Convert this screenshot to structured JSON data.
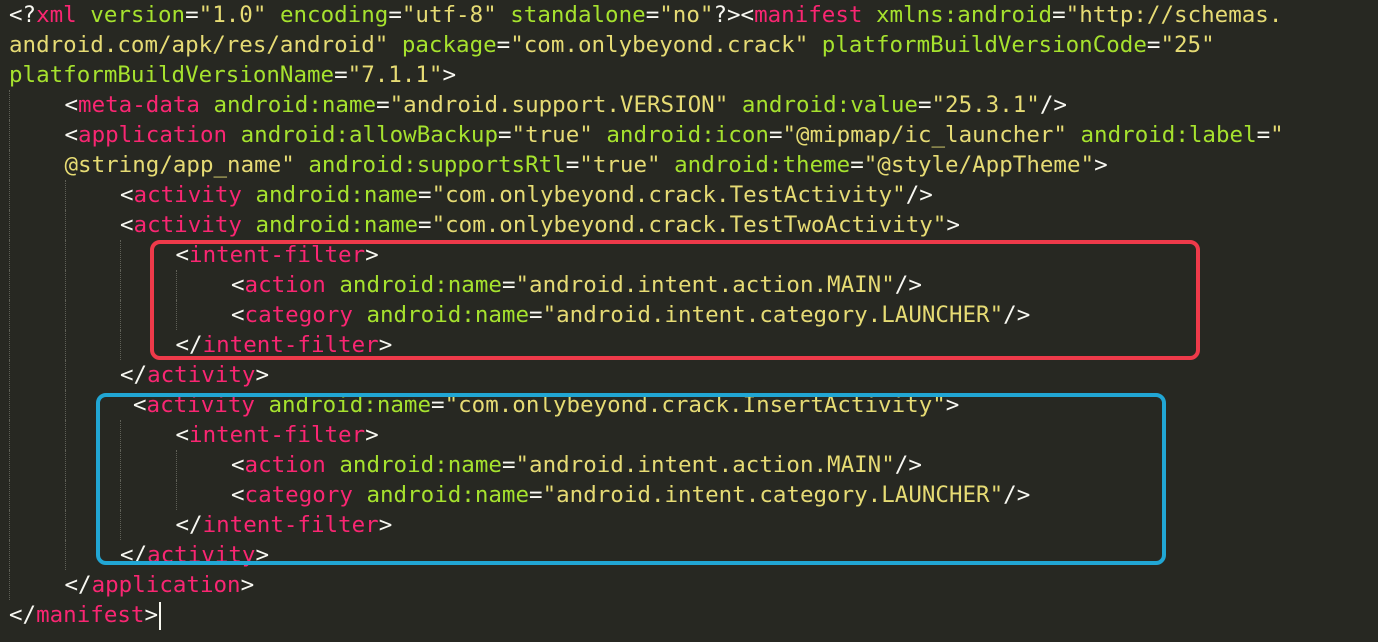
{
  "editor": {
    "theme_colors": {
      "background": "#272822",
      "tag": "#f92672",
      "attribute": "#a6e22e",
      "string": "#e6db74",
      "punctuation": "#f8f8f2"
    },
    "lines": [
      {
        "indent": 0,
        "tokens": [
          {
            "t": "<?",
            "c": "punct"
          },
          {
            "t": "xml",
            "c": "tag"
          },
          {
            "t": " ",
            "c": "plain"
          },
          {
            "t": "version",
            "c": "attr"
          },
          {
            "t": "=",
            "c": "punct"
          },
          {
            "t": "\"1.0\"",
            "c": "str"
          },
          {
            "t": " ",
            "c": "plain"
          },
          {
            "t": "encoding",
            "c": "attr"
          },
          {
            "t": "=",
            "c": "punct"
          },
          {
            "t": "\"utf-8\"",
            "c": "str"
          },
          {
            "t": " ",
            "c": "plain"
          },
          {
            "t": "standalone",
            "c": "attr"
          },
          {
            "t": "=",
            "c": "punct"
          },
          {
            "t": "\"no\"",
            "c": "str"
          },
          {
            "t": "?><",
            "c": "punct"
          },
          {
            "t": "manifest",
            "c": "tag"
          },
          {
            "t": " ",
            "c": "plain"
          },
          {
            "t": "xmlns:android",
            "c": "attr"
          },
          {
            "t": "=",
            "c": "punct"
          },
          {
            "t": "\"http://schemas.",
            "c": "str"
          }
        ]
      },
      {
        "indent": 0,
        "tokens": [
          {
            "t": "android.com/apk/res/android\"",
            "c": "str"
          },
          {
            "t": " ",
            "c": "plain"
          },
          {
            "t": "package",
            "c": "attr"
          },
          {
            "t": "=",
            "c": "punct"
          },
          {
            "t": "\"com.onlybeyond.crack\"",
            "c": "str"
          },
          {
            "t": " ",
            "c": "plain"
          },
          {
            "t": "platformBuildVersionCode",
            "c": "attr"
          },
          {
            "t": "=",
            "c": "punct"
          },
          {
            "t": "\"25\"",
            "c": "str"
          }
        ]
      },
      {
        "indent": 0,
        "tokens": [
          {
            "t": "platformBuildVersionName",
            "c": "attr"
          },
          {
            "t": "=",
            "c": "punct"
          },
          {
            "t": "\"7.1.1\"",
            "c": "str"
          },
          {
            "t": ">",
            "c": "punct"
          }
        ]
      },
      {
        "indent": 1,
        "tokens": [
          {
            "t": "<",
            "c": "punct"
          },
          {
            "t": "meta-data",
            "c": "tag"
          },
          {
            "t": " ",
            "c": "plain"
          },
          {
            "t": "android:name",
            "c": "attr"
          },
          {
            "t": "=",
            "c": "punct"
          },
          {
            "t": "\"android.support.VERSION\"",
            "c": "str"
          },
          {
            "t": " ",
            "c": "plain"
          },
          {
            "t": "android:value",
            "c": "attr"
          },
          {
            "t": "=",
            "c": "punct"
          },
          {
            "t": "\"25.3.1\"",
            "c": "str"
          },
          {
            "t": "/>",
            "c": "punct"
          }
        ]
      },
      {
        "indent": 1,
        "tokens": [
          {
            "t": "<",
            "c": "punct"
          },
          {
            "t": "application",
            "c": "tag"
          },
          {
            "t": " ",
            "c": "plain"
          },
          {
            "t": "android:allowBackup",
            "c": "attr"
          },
          {
            "t": "=",
            "c": "punct"
          },
          {
            "t": "\"true\"",
            "c": "str"
          },
          {
            "t": " ",
            "c": "plain"
          },
          {
            "t": "android:icon",
            "c": "attr"
          },
          {
            "t": "=",
            "c": "punct"
          },
          {
            "t": "\"@mipmap/ic_launcher\"",
            "c": "str"
          },
          {
            "t": " ",
            "c": "plain"
          },
          {
            "t": "android:label",
            "c": "attr"
          },
          {
            "t": "=",
            "c": "punct"
          },
          {
            "t": "\"",
            "c": "str"
          }
        ]
      },
      {
        "indent": 1,
        "tokens": [
          {
            "t": "@string/app_name\"",
            "c": "str"
          },
          {
            "t": " ",
            "c": "plain"
          },
          {
            "t": "android:supportsRtl",
            "c": "attr"
          },
          {
            "t": "=",
            "c": "punct"
          },
          {
            "t": "\"true\"",
            "c": "str"
          },
          {
            "t": " ",
            "c": "plain"
          },
          {
            "t": "android:theme",
            "c": "attr"
          },
          {
            "t": "=",
            "c": "punct"
          },
          {
            "t": "\"@style/AppTheme\"",
            "c": "str"
          },
          {
            "t": ">",
            "c": "punct"
          }
        ]
      },
      {
        "indent": 2,
        "tokens": [
          {
            "t": "<",
            "c": "punct"
          },
          {
            "t": "activity",
            "c": "tag"
          },
          {
            "t": " ",
            "c": "plain"
          },
          {
            "t": "android:name",
            "c": "attr"
          },
          {
            "t": "=",
            "c": "punct"
          },
          {
            "t": "\"com.onlybeyond.crack.TestActivity\"",
            "c": "str"
          },
          {
            "t": "/>",
            "c": "punct"
          }
        ]
      },
      {
        "indent": 2,
        "tokens": [
          {
            "t": "<",
            "c": "punct"
          },
          {
            "t": "activity",
            "c": "tag"
          },
          {
            "t": " ",
            "c": "plain"
          },
          {
            "t": "android:name",
            "c": "attr"
          },
          {
            "t": "=",
            "c": "punct"
          },
          {
            "t": "\"com.onlybeyond.crack.TestTwoActivity\"",
            "c": "str"
          },
          {
            "t": ">",
            "c": "punct"
          }
        ]
      },
      {
        "indent": 3,
        "tokens": [
          {
            "t": "<",
            "c": "punct"
          },
          {
            "t": "intent-filter",
            "c": "tag"
          },
          {
            "t": ">",
            "c": "punct"
          }
        ]
      },
      {
        "indent": 4,
        "tokens": [
          {
            "t": "<",
            "c": "punct"
          },
          {
            "t": "action",
            "c": "tag"
          },
          {
            "t": " ",
            "c": "plain"
          },
          {
            "t": "android:name",
            "c": "attr"
          },
          {
            "t": "=",
            "c": "punct"
          },
          {
            "t": "\"android.intent.action.MAIN\"",
            "c": "str"
          },
          {
            "t": "/>",
            "c": "punct"
          }
        ]
      },
      {
        "indent": 4,
        "tokens": [
          {
            "t": "<",
            "c": "punct"
          },
          {
            "t": "category",
            "c": "tag"
          },
          {
            "t": " ",
            "c": "plain"
          },
          {
            "t": "android:name",
            "c": "attr"
          },
          {
            "t": "=",
            "c": "punct"
          },
          {
            "t": "\"android.intent.category.LAUNCHER\"",
            "c": "str"
          },
          {
            "t": "/>",
            "c": "punct"
          }
        ]
      },
      {
        "indent": 3,
        "tokens": [
          {
            "t": "</",
            "c": "punct"
          },
          {
            "t": "intent-filter",
            "c": "tag"
          },
          {
            "t": ">",
            "c": "punct"
          }
        ]
      },
      {
        "indent": 2,
        "tokens": [
          {
            "t": "</",
            "c": "punct"
          },
          {
            "t": "activity",
            "c": "tag"
          },
          {
            "t": ">",
            "c": "punct"
          }
        ]
      },
      {
        "indent": 2,
        "pad": 1,
        "tokens": [
          {
            "t": "<",
            "c": "punct"
          },
          {
            "t": "activity",
            "c": "tag"
          },
          {
            "t": " ",
            "c": "plain"
          },
          {
            "t": "android:name",
            "c": "attr"
          },
          {
            "t": "=",
            "c": "punct"
          },
          {
            "t": "\"com.onlybeyond.crack.InsertActivity\"",
            "c": "str"
          },
          {
            "t": ">",
            "c": "punct"
          }
        ]
      },
      {
        "indent": 3,
        "tokens": [
          {
            "t": "<",
            "c": "punct"
          },
          {
            "t": "intent-filter",
            "c": "tag"
          },
          {
            "t": ">",
            "c": "punct"
          }
        ]
      },
      {
        "indent": 4,
        "tokens": [
          {
            "t": "<",
            "c": "punct"
          },
          {
            "t": "action",
            "c": "tag"
          },
          {
            "t": " ",
            "c": "plain"
          },
          {
            "t": "android:name",
            "c": "attr"
          },
          {
            "t": "=",
            "c": "punct"
          },
          {
            "t": "\"android.intent.action.MAIN\"",
            "c": "str"
          },
          {
            "t": "/>",
            "c": "punct"
          }
        ]
      },
      {
        "indent": 4,
        "tokens": [
          {
            "t": "<",
            "c": "punct"
          },
          {
            "t": "category",
            "c": "tag"
          },
          {
            "t": " ",
            "c": "plain"
          },
          {
            "t": "android:name",
            "c": "attr"
          },
          {
            "t": "=",
            "c": "punct"
          },
          {
            "t": "\"android.intent.category.LAUNCHER\"",
            "c": "str"
          },
          {
            "t": "/>",
            "c": "punct"
          }
        ]
      },
      {
        "indent": 3,
        "tokens": [
          {
            "t": "</",
            "c": "punct"
          },
          {
            "t": "intent-filter",
            "c": "tag"
          },
          {
            "t": ">",
            "c": "punct"
          }
        ]
      },
      {
        "indent": 2,
        "tokens": [
          {
            "t": "</",
            "c": "punct"
          },
          {
            "t": "activity",
            "c": "tag"
          },
          {
            "t": ">",
            "c": "punct"
          }
        ]
      },
      {
        "indent": 1,
        "tokens": [
          {
            "t": "</",
            "c": "punct"
          },
          {
            "t": "application",
            "c": "tag"
          },
          {
            "t": ">",
            "c": "punct"
          }
        ]
      },
      {
        "indent": 0,
        "cursor": true,
        "tokens": [
          {
            "t": "</",
            "c": "punct"
          },
          {
            "t": "manifest",
            "c": "tag"
          },
          {
            "t": ">",
            "c": "punct"
          }
        ]
      }
    ]
  },
  "annotations": {
    "red_box_color": "#ee3a4a",
    "blue_box_color": "#21a6d4"
  }
}
